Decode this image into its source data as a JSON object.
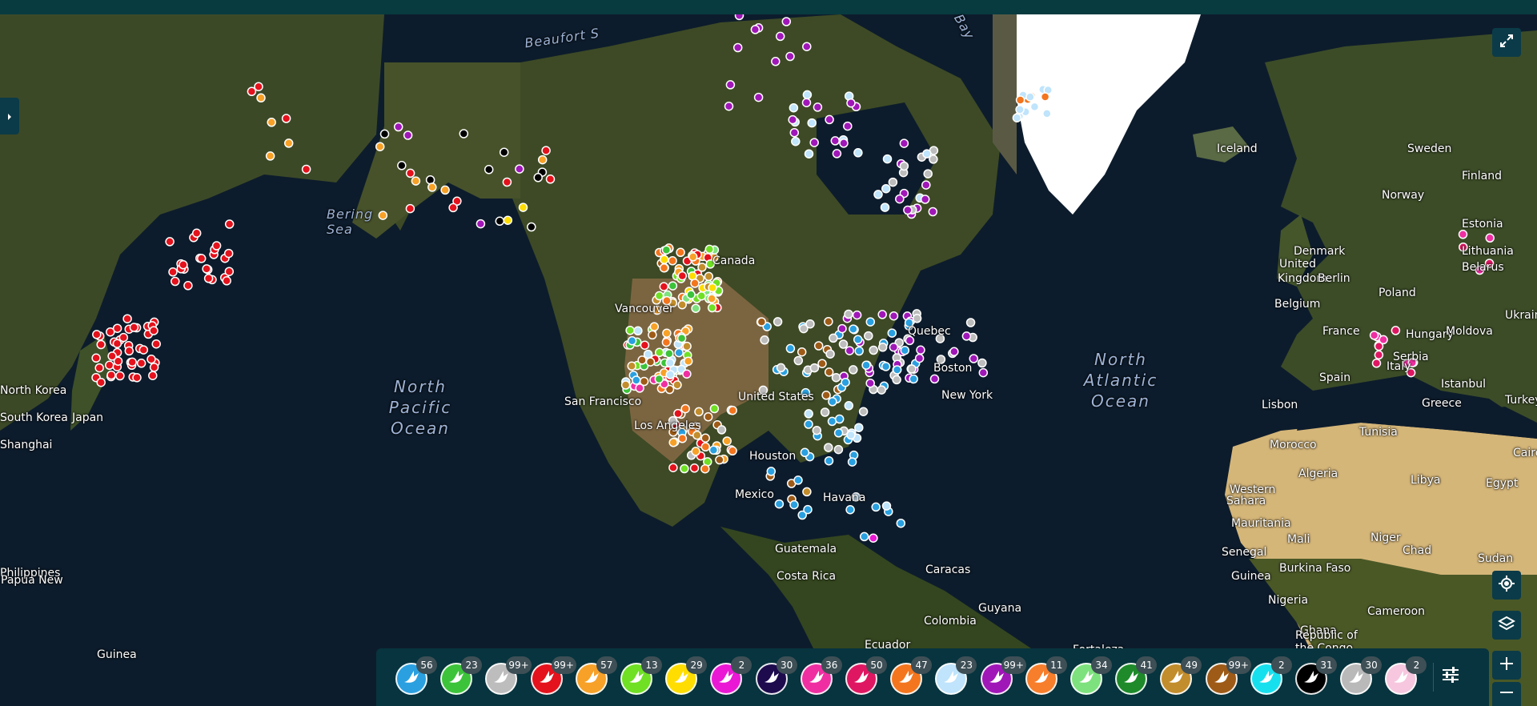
{
  "map": {
    "labels": {
      "oceans": [
        {
          "name": "North Pacific Ocean",
          "lines": [
            "North",
            "Pacific",
            "Ocean"
          ]
        },
        {
          "name": "North Atlantic Ocean",
          "lines": [
            "North",
            "Atlantic",
            "Ocean"
          ]
        }
      ],
      "seas": [
        "Bering",
        "Sea",
        "Beaufort S",
        "Bay"
      ],
      "places": [
        "Iceland",
        "Sweden",
        "Finland",
        "Norway",
        "Estonia",
        "Lithuania",
        "Belarus",
        "Denmark",
        "United",
        "Kingdom",
        "Berlin",
        "Belgium",
        "Poland",
        "Ukraine",
        "France",
        "Hungary",
        "Moldova",
        "Serbia",
        "Italy",
        "Istanbul",
        "Spain",
        "Lisbon",
        "Greece",
        "Turkey",
        "Morocco",
        "Tunisia",
        "Algeria",
        "Libya",
        "Egypt",
        "Western",
        "Sahara",
        "Mauritania",
        "Mali",
        "Niger",
        "Chad",
        "Sudan",
        "Senegal",
        "Guinea",
        "Burkina Faso",
        "Nigeria",
        "Ghana",
        "Cameroon",
        "Republic of",
        "the Congo",
        "Cairo",
        "Boston",
        "New York",
        "Quebec",
        "Houston",
        "Mexico",
        "Havana",
        "Guatemala",
        "Costa Rica",
        "Caracas",
        "Colombia",
        "Guyana",
        "Ecuador",
        "Fortaleza",
        "San Francisco",
        "Los Angeles",
        "Vancouver",
        "Canada",
        "United States",
        "Japan",
        "North Korea",
        "South Korea",
        "Shanghai",
        "Philippines",
        "Papua New",
        "Guinea"
      ]
    },
    "colors": {
      "land": "#3b4a26",
      "ocean": "#0d1c2c",
      "ice": "#ffffff",
      "desert": "#d9b877"
    }
  },
  "controls": {
    "fullscreen_icon": "expand-icon",
    "locate_icon": "crosshair-icon",
    "layers_icon": "layers-icon",
    "zoom_in_icon": "plus-icon",
    "zoom_out_icon": "minus-icon",
    "side_toggle_icon": "chevron-right-icon",
    "filter_icon": "sliders-icon"
  },
  "legend": {
    "items": [
      {
        "color": "#2aa0e0",
        "count": "56"
      },
      {
        "color": "#3cc33a",
        "count": "23"
      },
      {
        "color": "#bdbdbd",
        "count": "99+"
      },
      {
        "color": "#e4121c",
        "count": "99+"
      },
      {
        "color": "#f7a128",
        "count": "57"
      },
      {
        "color": "#6fe024",
        "count": "13"
      },
      {
        "color": "#ffdd00",
        "count": "29"
      },
      {
        "color": "#ea18d5",
        "count": "2"
      },
      {
        "color": "#1d0b4d",
        "count": "30"
      },
      {
        "color": "#ef2fa1",
        "count": "36"
      },
      {
        "color": "#df1762",
        "count": "50"
      },
      {
        "color": "#f3761e",
        "count": "47"
      },
      {
        "color": "#bfe4fb",
        "count": "23"
      },
      {
        "color": "#a017b8",
        "count": "99+"
      },
      {
        "color": "#f77e2b",
        "count": "11"
      },
      {
        "color": "#7de27d",
        "count": "34"
      },
      {
        "color": "#1e8a2a",
        "count": "41"
      },
      {
        "color": "#c28d2c",
        "count": "49"
      },
      {
        "color": "#9e5b17",
        "count": "99+"
      },
      {
        "color": "#17e0ee",
        "count": "2"
      },
      {
        "color": "#000000",
        "count": "31"
      },
      {
        "color": "#b9b9b9",
        "count": "30"
      },
      {
        "color": "#f6c7df",
        "count": "2"
      }
    ]
  }
}
